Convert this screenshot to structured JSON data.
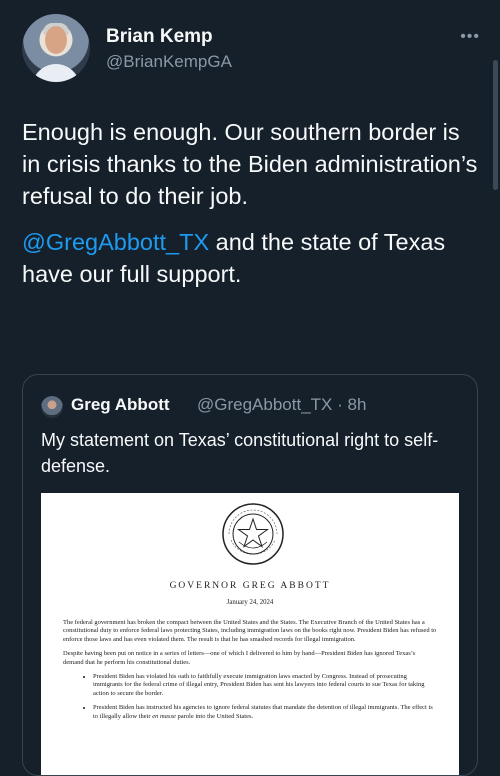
{
  "author": {
    "name": "Brian Kemp",
    "handle": "@BrianKempGA",
    "more_icon": "ellipsis-icon"
  },
  "tweet": {
    "paragraph1": "Enough is enough. Our southern border is in crisis thanks to the Biden administration’s refusal to do their job.",
    "mention": "@GregAbbott_TX",
    "paragraph2_rest": " and the state of Texas have our full support."
  },
  "quote": {
    "name": "Greg Abbott",
    "handle": "@GregAbbott_TX · 8h",
    "text": "My statement on Texas’ constitutional right to self-defense."
  },
  "document": {
    "seal_text": "THE STATE OF TEXAS · GOVERNOR",
    "heading": "GOVERNOR GREG ABBOTT",
    "date": "January 24, 2024",
    "p1": "The federal government has broken the compact between the United States and the States.  The Executive Branch of the United States has a constitutional duty to enforce federal laws protecting States, including immigration laws on the books right now.  President Biden has refused to enforce those laws and has even violated them.  The result is that he has smashed records for illegal immigration.",
    "p2": "Despite having been put on notice in a series of letters—one of which I delivered to him by hand—President Biden has ignored Texas’s demand that he perform his constitutional duties.",
    "b1": "President Biden has violated his oath to faithfully execute immigration laws enacted by Congress. Instead of prosecuting immigrants for the federal crime of illegal entry, President Biden has sent his lawyers into federal courts to sue Texas for taking action to secure the border.",
    "b2_pre": "President Biden has instructed his agencies to ignore federal statutes that mandate the detention of illegal immigrants.  The effect is to illegally allow their ",
    "b2_em": "en masse",
    "b2_post": " parole into the United States."
  },
  "colors": {
    "background": "#15202b",
    "text": "#f7f9f9",
    "secondary": "#8b98a5",
    "link": "#1d9bf0",
    "border": "#38444d"
  }
}
